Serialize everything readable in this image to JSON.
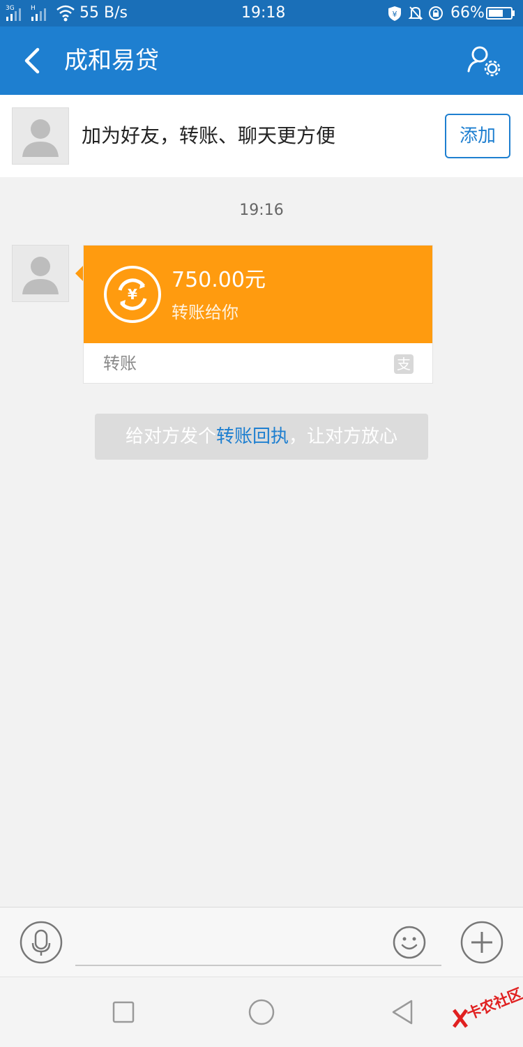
{
  "status_bar": {
    "network_3g": "3G",
    "network_h": "H",
    "speed": "55 B/s",
    "time": "19:18",
    "battery": "66%"
  },
  "header": {
    "title": "成和易贷",
    "back_icon": "chevron-left-icon",
    "profile_icon": "user-settings-icon"
  },
  "friend_prompt": {
    "text": "加为好友，转账、聊天更方便",
    "add_label": "添加"
  },
  "chat": {
    "timestamp": "19:16",
    "transfer": {
      "amount": "750.00元",
      "subtitle": "转账给你",
      "footer_label": "转账",
      "brand_glyph": "支"
    },
    "hint": {
      "before": "给对方发个",
      "link": "转账回执",
      "after": "，让对方放心"
    }
  },
  "input_bar": {
    "voice_icon": "microphone-icon",
    "emoji_icon": "smiley-icon",
    "more_icon": "plus-icon"
  },
  "watermark": {
    "text": "卡农社区"
  },
  "colors": {
    "header": "#1e7fd0",
    "status": "#1a6fb8",
    "transfer_card": "#ff9b0f",
    "link": "#1e7fd0"
  }
}
